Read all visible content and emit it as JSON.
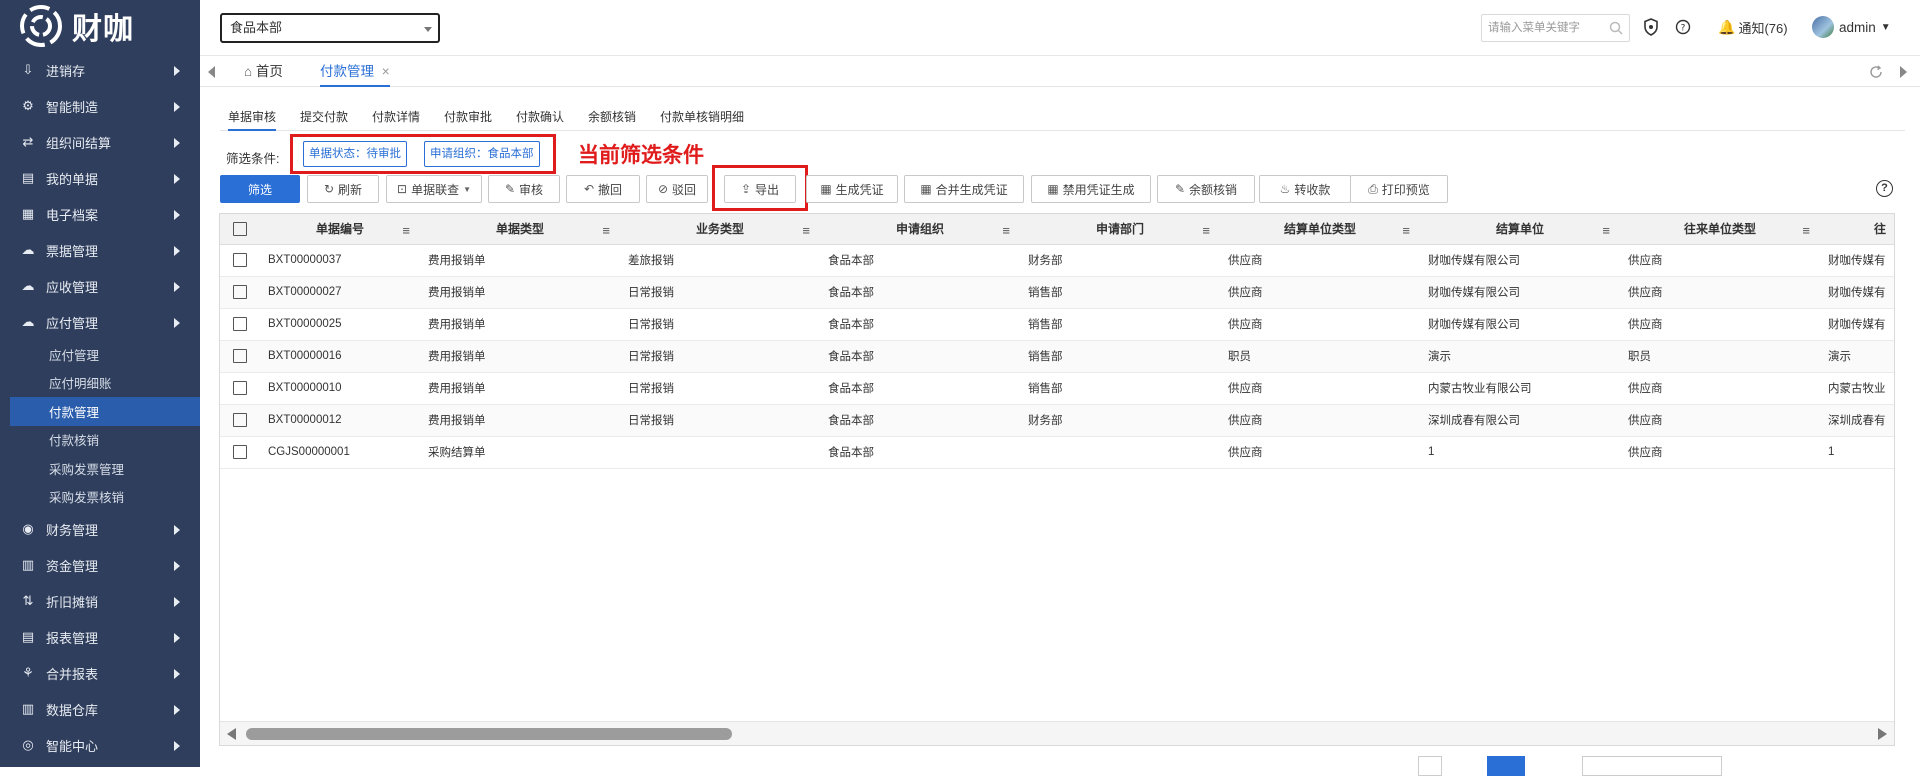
{
  "brand": {
    "logo_text": "财咖"
  },
  "sidebar": {
    "items": [
      {
        "icon": "inbox-icon",
        "glyph": "⇩",
        "label": "进销存"
      },
      {
        "icon": "gears-icon",
        "glyph": "⚙",
        "label": "智能制造"
      },
      {
        "icon": "transfer-icon",
        "glyph": "⇄",
        "label": "组织间结算"
      },
      {
        "icon": "document-icon",
        "glyph": "▤",
        "label": "我的单据"
      },
      {
        "icon": "archive-icon",
        "glyph": "▦",
        "label": "电子档案"
      },
      {
        "icon": "cloud-icon",
        "glyph": "☁",
        "label": "票据管理"
      },
      {
        "icon": "cloud-icon",
        "glyph": "☁",
        "label": "应收管理"
      },
      {
        "icon": "cloud-icon",
        "glyph": "☁",
        "label": "应付管理"
      }
    ],
    "sub_items": [
      {
        "label": "应付管理",
        "active": false
      },
      {
        "label": "应付明细账",
        "active": false
      },
      {
        "label": "付款管理",
        "active": true
      },
      {
        "label": "付款核销",
        "active": false
      },
      {
        "label": "采购发票管理",
        "active": false
      },
      {
        "label": "采购发票核销",
        "active": false
      }
    ],
    "items_after": [
      {
        "icon": "finance-icon",
        "glyph": "◉",
        "label": "财务管理"
      },
      {
        "icon": "bar-chart-icon",
        "glyph": "▥",
        "label": "资金管理"
      },
      {
        "icon": "depreciation-icon",
        "glyph": "⇅",
        "label": "折旧摊销"
      },
      {
        "icon": "report-icon",
        "glyph": "▤",
        "label": "报表管理"
      },
      {
        "icon": "merge-icon",
        "glyph": "⚘",
        "label": "合并报表"
      },
      {
        "icon": "warehouse-icon",
        "glyph": "▥",
        "label": "数据仓库"
      },
      {
        "icon": "compass-icon",
        "glyph": "◎",
        "label": "智能中心"
      }
    ]
  },
  "header": {
    "org_select": "食品本部",
    "search_placeholder": "请输入菜单关键字",
    "notice": "通知(76)",
    "user": "admin"
  },
  "tabs": {
    "home": "首页",
    "current": "付款管理"
  },
  "subtabs": [
    "单据审核",
    "提交付款",
    "付款详情",
    "付款审批",
    "付款确认",
    "余额核销",
    "付款单核销明细"
  ],
  "filter": {
    "label": "筛选条件:",
    "chips": [
      "单据状态：待审批",
      "申请组织：食品本部"
    ],
    "annotation": "当前筛选条件"
  },
  "toolbar": {
    "filter": "筛选",
    "refresh": "刷新",
    "link_query": "单据联查",
    "audit": "审核",
    "revoke": "撤回",
    "reject": "驳回",
    "export": "导出",
    "gen_voucher": "生成凭证",
    "merge_voucher": "合并生成凭证",
    "disable_voucher": "禁用凭证生成",
    "balance_writeoff": "余额核销",
    "transfer_receipt": "转收款",
    "print_preview": "打印预览"
  },
  "table": {
    "columns": [
      "单据编号",
      "单据类型",
      "业务类型",
      "申请组织",
      "申请部门",
      "结算单位类型",
      "结算单位",
      "往来单位类型",
      "往"
    ],
    "rows": [
      [
        "BXT00000037",
        "费用报销单",
        "差旅报销",
        "食品本部",
        "财务部",
        "供应商",
        "财咖传媒有限公司",
        "供应商",
        "财咖传媒有"
      ],
      [
        "BXT00000027",
        "费用报销单",
        "日常报销",
        "食品本部",
        "销售部",
        "供应商",
        "财咖传媒有限公司",
        "供应商",
        "财咖传媒有"
      ],
      [
        "BXT00000025",
        "费用报销单",
        "日常报销",
        "食品本部",
        "销售部",
        "供应商",
        "财咖传媒有限公司",
        "供应商",
        "财咖传媒有"
      ],
      [
        "BXT00000016",
        "费用报销单",
        "日常报销",
        "食品本部",
        "销售部",
        "职员",
        "演示",
        "职员",
        "演示"
      ],
      [
        "BXT00000010",
        "费用报销单",
        "日常报销",
        "食品本部",
        "销售部",
        "供应商",
        "内蒙古牧业有限公司",
        "供应商",
        "内蒙古牧业"
      ],
      [
        "BXT00000012",
        "费用报销单",
        "日常报销",
        "食品本部",
        "财务部",
        "供应商",
        "深圳成春有限公司",
        "供应商",
        "深圳成春有"
      ],
      [
        "CGJS00000001",
        "采购结算单",
        "",
        "食品本部",
        "",
        "供应商",
        "1",
        "供应商",
        "1"
      ]
    ]
  },
  "colors": {
    "sidebar_bg": "#2f3e5c",
    "accent": "#2a6fd6",
    "annotation": "#e01b1b"
  }
}
